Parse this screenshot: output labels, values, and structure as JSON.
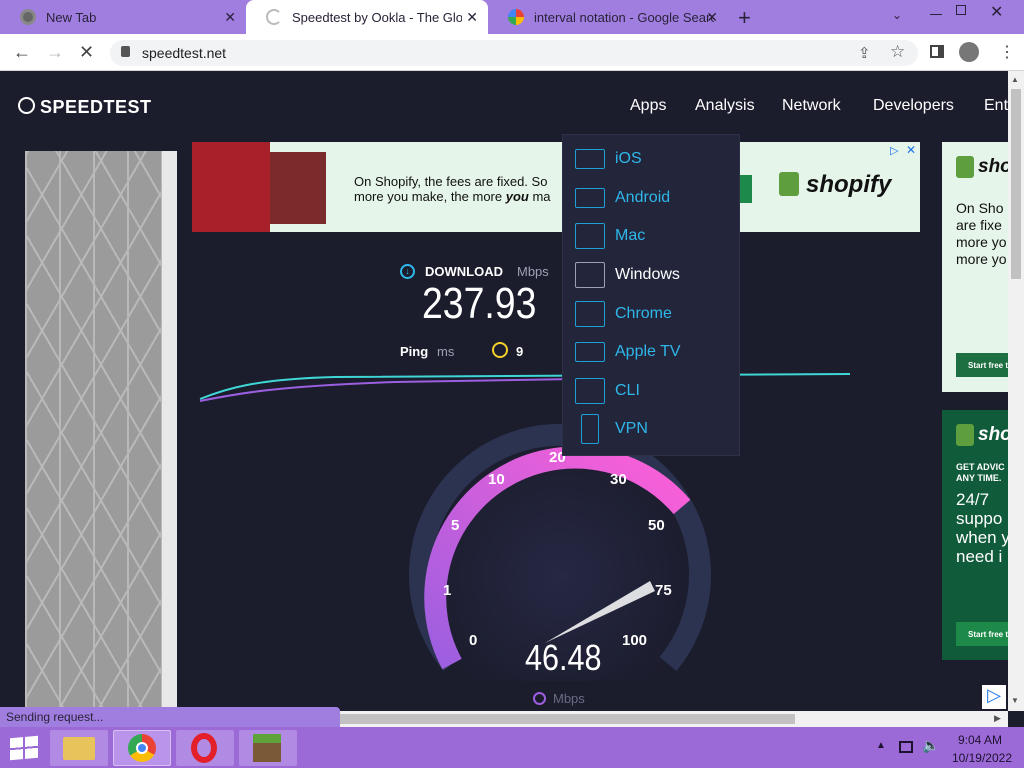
{
  "tabs": [
    {
      "title": "New Tab",
      "close": "✕"
    },
    {
      "title": "Speedtest by Ookla - The Global",
      "close": "✕"
    },
    {
      "title": "interval notation - Google Search",
      "close": "✕"
    }
  ],
  "toolbar": {
    "url": "speedtest.net",
    "new_tab": "+"
  },
  "site": {
    "logo": "SPEEDTEST",
    "nav": [
      "Apps",
      "Analysis",
      "Network",
      "Developers",
      "Ent"
    ],
    "apps_menu": [
      "iOS",
      "Android",
      "Mac",
      "Windows",
      "Chrome",
      "Apple TV",
      "CLI",
      "VPN"
    ],
    "apps_selected": "Windows"
  },
  "ad_top": {
    "line1": "On Shopify, the fees are fixed. So",
    "line2_a": "more you make, the more ",
    "line2_b": "you",
    "line2_c": " ma",
    "brand": "shopify"
  },
  "ad_right1": {
    "brand": "sho",
    "text": [
      "On Sho",
      "are fixe",
      "more yo",
      "more yo"
    ],
    "cta": "Start free t"
  },
  "ad_right2": {
    "brand": "sho",
    "small": [
      "GET ADVIC",
      "ANY TIME."
    ],
    "text": [
      "24/7",
      "suppo",
      "when y",
      "need i"
    ],
    "cta": "Start free t"
  },
  "result": {
    "download_label": "DOWNLOAD",
    "unit": "Mbps",
    "download_value": "237.93",
    "ping_label": "Ping",
    "ping_unit": "ms",
    "ping_value": "9"
  },
  "gauge": {
    "ticks": [
      "0",
      "1",
      "5",
      "10",
      "20",
      "30",
      "50",
      "75",
      "100"
    ],
    "current_value": "46.48",
    "unit": "Mbps",
    "needle_value": 46.48
  },
  "status": {
    "text": "Sending request..."
  },
  "taskbar": {
    "time": "9:04 AM",
    "date": "10/19/2022"
  },
  "colors": {
    "accent": "#2fb7ea",
    "gauge_gradient_start": "#9b5fe0",
    "gauge_gradient_end": "#ff5fd7",
    "page_bg": "#1b1c2c",
    "chrome_purple": "#a07ee0"
  }
}
